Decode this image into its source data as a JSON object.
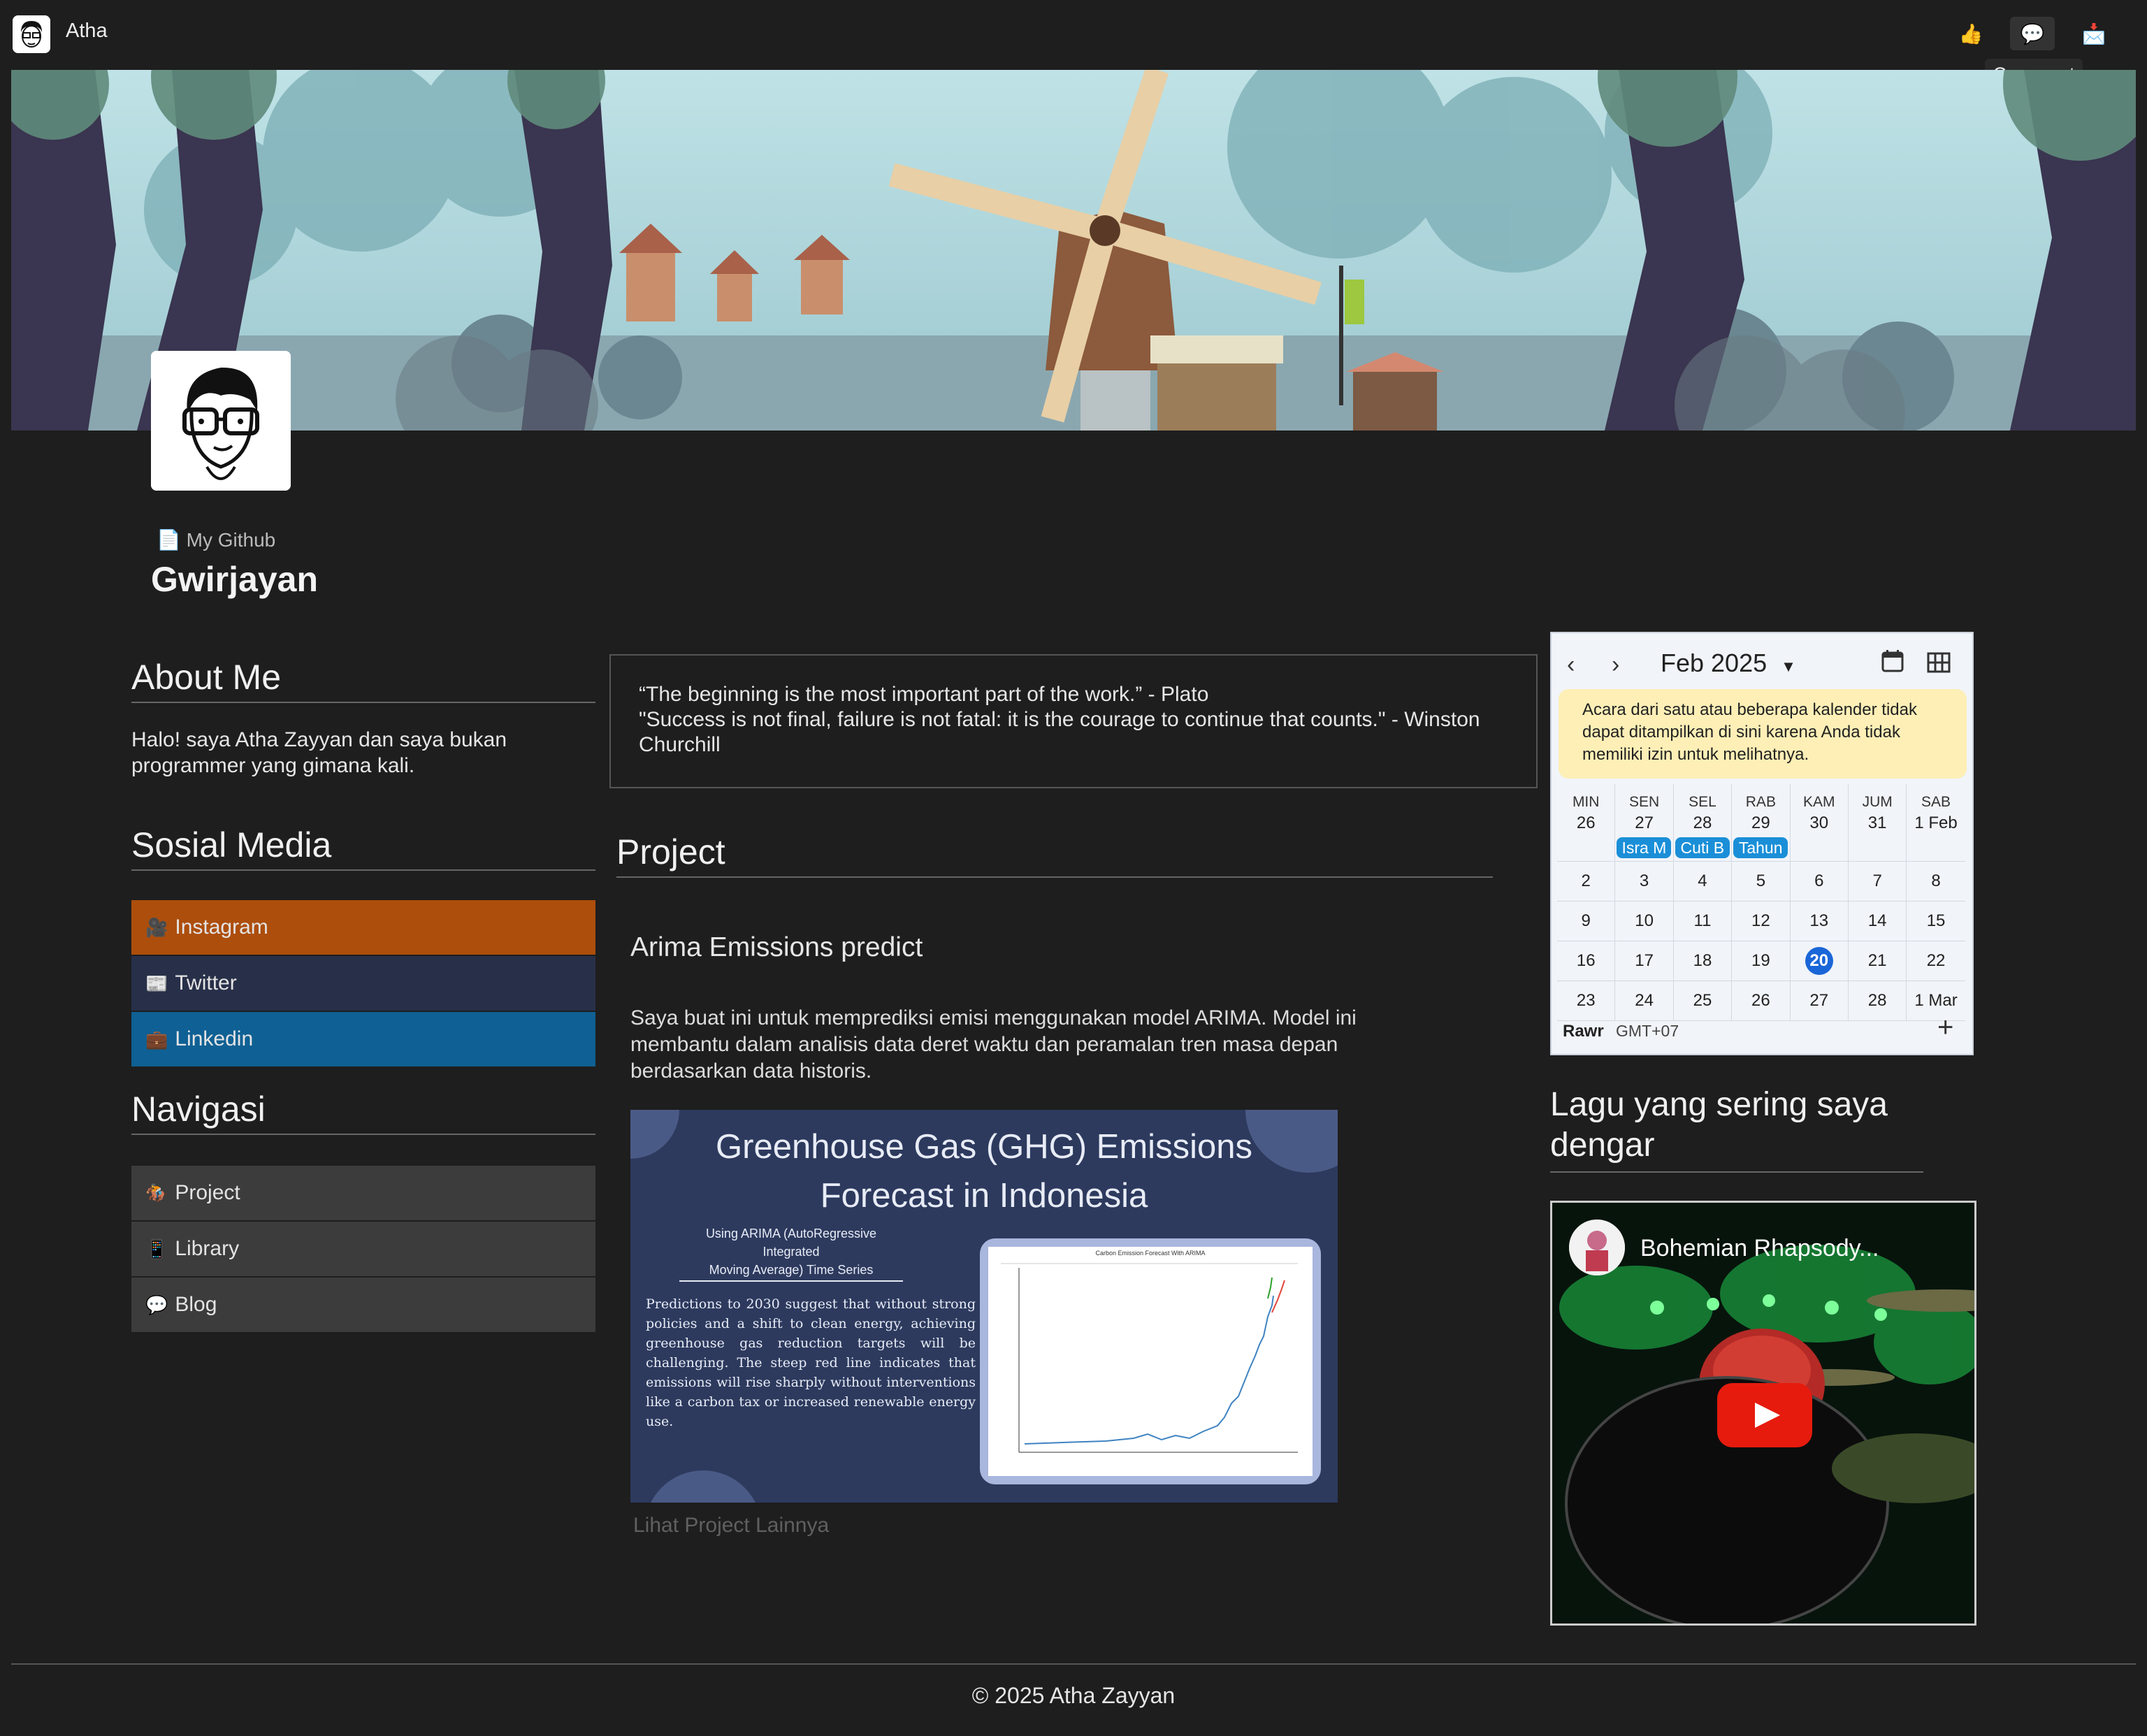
{
  "app": {
    "title": "Atha"
  },
  "topbar": {
    "icons": [
      "thumbs-up-icon",
      "comment-icon",
      "mail-icon"
    ],
    "tooltip": "Comment"
  },
  "profile": {
    "github_link": "My Github",
    "name": "Gwirjayan"
  },
  "about": {
    "title": "About Me",
    "text": "Halo! saya Atha Zayyan dan saya bukan programmer yang gimana kali."
  },
  "social": {
    "title": "Sosial Media",
    "items": [
      {
        "label": "Instagram",
        "color": "#ad4e0c",
        "icon": "camera-icon"
      },
      {
        "label": "Twitter",
        "color": "#283049",
        "icon": "newspaper-icon"
      },
      {
        "label": "Linkedin",
        "color": "#0f6094",
        "icon": "briefcase-icon"
      }
    ]
  },
  "nav": {
    "title": "Navigasi",
    "items": [
      {
        "label": "Project",
        "icon": "horse-rider-icon"
      },
      {
        "label": "Library",
        "icon": "tablet-icon"
      },
      {
        "label": "Blog",
        "icon": "speech-bubble-icon"
      }
    ]
  },
  "quotes": {
    "line1": "“The beginning is the most important part of the work.” - Plato",
    "line2": "\"Success is not final, failure is not fatal: it is the courage to continue that counts.\" - Winston Churchill"
  },
  "project": {
    "section_title": "Project",
    "title": "Arima Emissions predict",
    "description": "Saya buat ini untuk memprediksi emisi menggunakan model ARIMA. Model ini membantu dalam analisis data deret waktu dan peramalan tren masa depan berdasarkan data historis.",
    "card": {
      "headline1": "Greenhouse Gas (GHG) Emissions",
      "headline2": "Forecast in Indonesia",
      "sub1": "Using ARIMA (AutoRegressive Integrated",
      "sub2": "Moving Average) Time Series",
      "body": "Predictions to 2030 suggest that without strong policies and a shift to clean energy, achieving greenhouse gas reduction targets will be challenging. The steep red line indicates that emissions will rise sharply without interventions like a carbon tax or increased renewable energy use.",
      "chart_title": "Carbon Emission Forecast With ARIMA"
    },
    "more_link": "Lihat Project Lainnya"
  },
  "calendar": {
    "month": "Feb 2025",
    "notice": "Acara dari satu atau beberapa kalender tidak dapat ditampilkan di sini karena Anda tidak memiliki izin untuk melihatnya.",
    "days": [
      "MIN",
      "SEN",
      "SEL",
      "RAB",
      "KAM",
      "JUM",
      "SAB"
    ],
    "first_row": [
      "26",
      "27",
      "28",
      "29",
      "30",
      "31",
      "1 Feb"
    ],
    "events": [
      "",
      "Isra M",
      "Cuti B",
      "Tahun",
      "",
      "",
      ""
    ],
    "weeks": [
      [
        "2",
        "3",
        "4",
        "5",
        "6",
        "7",
        "8"
      ],
      [
        "9",
        "10",
        "11",
        "12",
        "13",
        "14",
        "15"
      ],
      [
        "16",
        "17",
        "18",
        "19",
        "20",
        "21",
        "22"
      ],
      [
        "23",
        "24",
        "25",
        "26",
        "27",
        "28",
        "1 Mar"
      ]
    ],
    "today": "20",
    "footer_name": "Rawr",
    "timezone": "GMT+07"
  },
  "song": {
    "title": "Lagu yang sering saya dengar",
    "video_title": "Bohemian Rhapsody..."
  },
  "footer": {
    "text": "© 2025 Atha Zayyan"
  }
}
